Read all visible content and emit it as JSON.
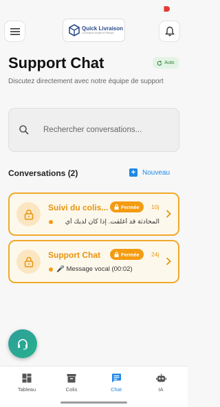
{
  "app": {
    "logo_title": "Quick Livraison",
    "logo_subtitle": "La livraison Simple et Efficace"
  },
  "header": {
    "title": "Support Chat",
    "auto_label": "Auto",
    "subtitle": "Discutez directement avec notre équipe de support"
  },
  "search": {
    "placeholder": "Rechercher conversations..."
  },
  "conversations": {
    "heading": "Conversations (2)",
    "new_label": "Nouveau",
    "items": [
      {
        "title": "Suivi du colis...",
        "status": "Fermée",
        "age": "10j",
        "preview": "المحادثة قد أغلقت. إذا كان لديك أي"
      },
      {
        "title": "Support Chat",
        "status": "Fermée",
        "age": "24j",
        "preview": "🎤 Message vocal (00:02)"
      }
    ]
  },
  "nav": {
    "items": [
      {
        "label": "Tableau",
        "icon": "dashboard-icon"
      },
      {
        "label": "Colis",
        "icon": "box-icon"
      },
      {
        "label": "Chat",
        "icon": "chat-icon",
        "active": true
      },
      {
        "label": "IA",
        "icon": "robot-icon"
      }
    ]
  },
  "colors": {
    "accent": "#1e88e5",
    "warning": "#f39c12",
    "success": "#2e7d32"
  }
}
